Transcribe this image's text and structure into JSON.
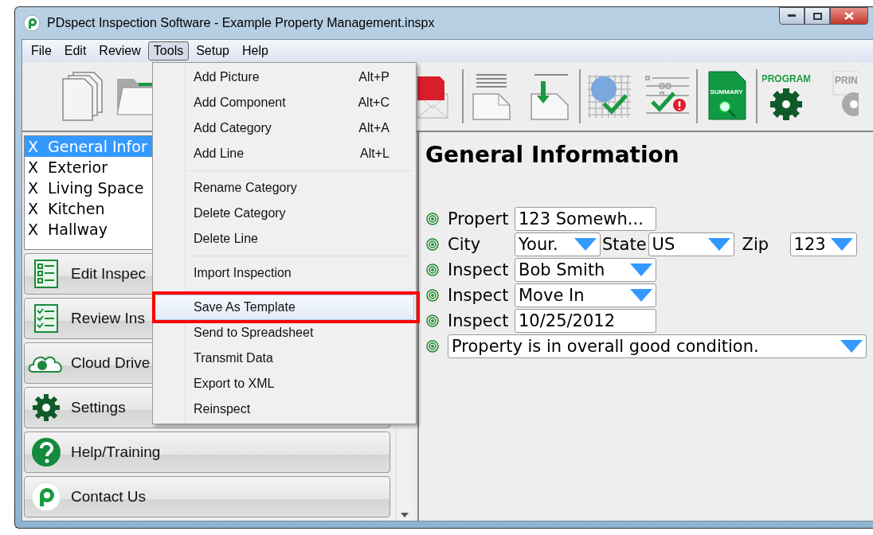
{
  "window": {
    "title": "PDspect Inspection Software - Example Property Management.inspx"
  },
  "menubar": [
    {
      "label": "File",
      "selected": false
    },
    {
      "label": "Edit",
      "selected": false
    },
    {
      "label": "Review",
      "selected": false
    },
    {
      "label": "Tools",
      "selected": true
    },
    {
      "label": "Setup",
      "selected": false
    },
    {
      "label": "Help",
      "selected": false
    }
  ],
  "toolbar": [
    {
      "kind": "new"
    },
    {
      "kind": "open"
    },
    {
      "kind": "pdf"
    },
    {
      "kind": "doc"
    },
    {
      "kind": "download"
    },
    {
      "kind": "chart"
    },
    {
      "kind": "checklist"
    },
    {
      "kind": "summary",
      "text": "SUMMARY"
    },
    {
      "kind": "program",
      "text": "PROGRAM"
    },
    {
      "kind": "print",
      "text": "PRIN"
    }
  ],
  "categories": [
    {
      "mark": "X",
      "label": "General Infor",
      "selected": true
    },
    {
      "mark": "X",
      "label": "Exterior",
      "selected": false
    },
    {
      "mark": "X",
      "label": "Living Space",
      "selected": false
    },
    {
      "mark": "X",
      "label": "Kitchen",
      "selected": false
    },
    {
      "mark": "X",
      "label": "Hallway",
      "selected": false
    }
  ],
  "nav_buttons": [
    {
      "kind": "list",
      "label": "Edit Inspec"
    },
    {
      "kind": "checklist",
      "label": "Review Ins"
    },
    {
      "kind": "cloud",
      "label": "Cloud Drive"
    },
    {
      "kind": "gear",
      "label": "Settings"
    },
    {
      "kind": "help",
      "label": "Help/Training"
    },
    {
      "kind": "logo",
      "label": "Contact Us"
    }
  ],
  "tools_menu": [
    [
      {
        "label": "Add Picture",
        "shortcut": "Alt+P",
        "selected": false,
        "callout": false
      },
      {
        "label": "Add Component",
        "shortcut": "Alt+C",
        "selected": false,
        "callout": false
      },
      {
        "label": "Add Category",
        "shortcut": "Alt+A",
        "selected": false,
        "callout": false
      },
      {
        "label": "Add Line",
        "shortcut": "Alt+L",
        "selected": false,
        "callout": false
      }
    ],
    [
      {
        "label": "Rename Category",
        "selected": false,
        "callout": false
      },
      {
        "label": "Delete Category",
        "selected": false,
        "callout": false
      },
      {
        "label": "Delete Line",
        "selected": false,
        "callout": false
      }
    ],
    [
      {
        "label": "Import Inspection",
        "selected": false,
        "callout": false
      }
    ],
    [
      {
        "label": "Save As Template",
        "selected": true,
        "callout": true
      },
      {
        "label": "Send to Spreadsheet",
        "selected": false,
        "callout": false
      },
      {
        "label": "Transmit Data",
        "selected": false,
        "callout": false
      },
      {
        "label": "Export to XML",
        "selected": false,
        "callout": false
      },
      {
        "label": "Reinspect",
        "selected": false,
        "callout": false
      }
    ]
  ],
  "section": {
    "title": "General Information",
    "rows": [
      [
        {
          "kind": "label",
          "text": "Propert"
        },
        {
          "kind": "text",
          "value": "123 Somewh..."
        }
      ],
      [
        {
          "kind": "label",
          "text": "City"
        },
        {
          "kind": "select",
          "value": "Your."
        },
        {
          "kind": "inline-label",
          "text": "State"
        },
        {
          "kind": "select",
          "value": "US"
        },
        {
          "kind": "inline-label",
          "text": "Zip"
        },
        {
          "kind": "select-small",
          "value": "123"
        }
      ],
      [
        {
          "kind": "label",
          "text": "Inspect"
        },
        {
          "kind": "select-wide",
          "value": "Bob Smith"
        }
      ],
      [
        {
          "kind": "label",
          "text": "Inspect"
        },
        {
          "kind": "select-wide",
          "value": "Move In"
        }
      ],
      [
        {
          "kind": "label",
          "text": "Inspect"
        },
        {
          "kind": "text",
          "value": "10/25/2012"
        }
      ],
      [
        {
          "kind": "select-full",
          "value": "Property is in overall good condition."
        }
      ]
    ]
  }
}
